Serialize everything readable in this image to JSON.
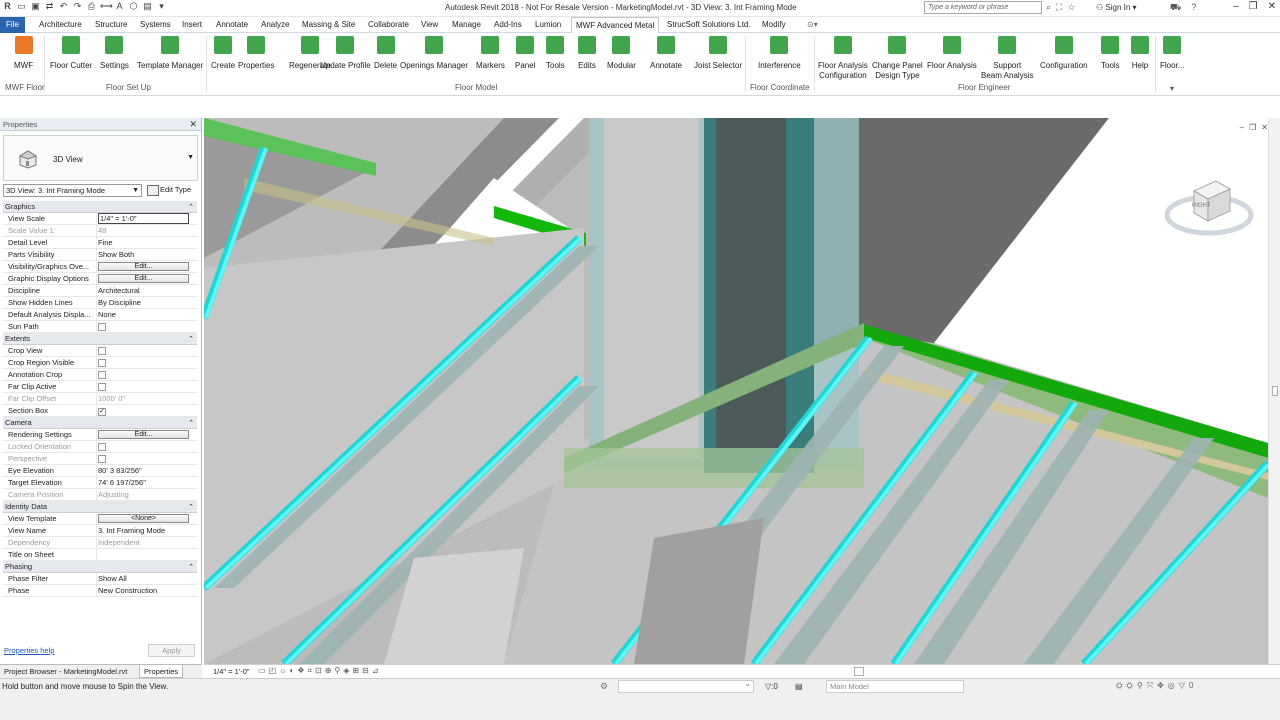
{
  "titlebar": {
    "title": "Autodesk Revit 2018 -  Not For Resale Version -     MarketingModel.rvt - 3D View: 3. Int Framing Mode",
    "search_placeholder": "Type a keyword or phrase",
    "sign_in": "Sign In"
  },
  "menu_tabs": [
    {
      "label": "File"
    },
    {
      "label": "Architecture"
    },
    {
      "label": "Structure"
    },
    {
      "label": "Systems"
    },
    {
      "label": "Insert"
    },
    {
      "label": "Annotate"
    },
    {
      "label": "Analyze"
    },
    {
      "label": "Massing & Site"
    },
    {
      "label": "Collaborate"
    },
    {
      "label": "View"
    },
    {
      "label": "Manage"
    },
    {
      "label": "Add-Ins"
    },
    {
      "label": "Lumion"
    },
    {
      "label": "MWF Advanced Metal"
    },
    {
      "label": "StrucSoft Solutions Ltd."
    },
    {
      "label": "Modify"
    }
  ],
  "ribbon": {
    "buttons": [
      {
        "label": "MWF",
        "icon": "mwf-logo-icon",
        "color": "#e86a10"
      },
      {
        "label": "Floor Cutter",
        "icon": "floor-cutter-icon",
        "color": "#2e9b3a"
      },
      {
        "label": "Settings",
        "icon": "settings-icon",
        "color": "#2e9b3a"
      },
      {
        "label": "Template Manager",
        "icon": "template-manager-icon",
        "color": "#2e9b3a"
      },
      {
        "label": "Create",
        "icon": "create-icon",
        "color": "#2e9b3a"
      },
      {
        "label": "Properties",
        "icon": "properties-icon",
        "color": "#2e9b3a"
      },
      {
        "label": "Regenerate",
        "icon": "regenerate-icon",
        "color": "#2e9b3a"
      },
      {
        "label": "Update Profile",
        "icon": "update-profile-icon",
        "color": "#2e9b3a"
      },
      {
        "label": "Delete",
        "icon": "delete-icon",
        "color": "#2e9b3a"
      },
      {
        "label": "Openings Manager",
        "icon": "openings-manager-icon",
        "color": "#2e9b3a"
      },
      {
        "label": "Markers",
        "icon": "markers-icon",
        "color": "#2e9b3a"
      },
      {
        "label": "Panel",
        "icon": "panel-icon",
        "color": "#2e9b3a"
      },
      {
        "label": "Tools",
        "icon": "tools-icon",
        "color": "#2e9b3a"
      },
      {
        "label": "Edits",
        "icon": "edits-icon",
        "color": "#2e9b3a"
      },
      {
        "label": "Modular",
        "icon": "modular-icon",
        "color": "#2e9b3a"
      },
      {
        "label": "Annotate",
        "icon": "annotate-icon",
        "color": "#2e9b3a"
      },
      {
        "label": "Joist Selector",
        "icon": "joist-selector-icon",
        "color": "#2e9b3a"
      },
      {
        "label": "Interference",
        "icon": "interference-icon",
        "color": "#2e9b3a"
      },
      {
        "label": "Floor Analysis\nConfiguration",
        "icon": "floor-analysis-configuration-icon",
        "color": "#2e9b3a"
      },
      {
        "label": "Change Panel\nDesign Type",
        "icon": "change-panel-design-type-icon",
        "color": "#2e9b3a"
      },
      {
        "label": "Floor Analysis",
        "icon": "floor-analysis-icon",
        "color": "#2e9b3a"
      },
      {
        "label": "Support\nBeam Analysis",
        "icon": "support-beam-analysis-icon",
        "color": "#2e9b3a"
      },
      {
        "label": "Configuration",
        "icon": "configuration-icon",
        "color": "#2e9b3a"
      },
      {
        "label": "Tools",
        "icon": "tools-icon",
        "color": "#2e9b3a"
      },
      {
        "label": "Help",
        "icon": "help-icon",
        "color": "#2e9b3a"
      },
      {
        "label": "Floor...",
        "icon": "floor-panel-icon",
        "color": "#2e9b3a"
      }
    ],
    "panels": [
      {
        "label": "MWF Floor"
      },
      {
        "label": "Floor Set Up"
      },
      {
        "label": "Floor Model"
      },
      {
        "label": "Floor Coordinate"
      },
      {
        "label": "Floor Engineer"
      }
    ]
  },
  "properties": {
    "header": "Properties",
    "type_name": "3D View",
    "instance": "3D View: 3. Int Framing Mode",
    "edit_type": "Edit Type",
    "sections": [
      {
        "name": "Graphics",
        "rows": [
          {
            "k": "View Scale",
            "v": "1/4\" = 1'-0\"",
            "kind": "input"
          },
          {
            "k": "Scale Value    1:",
            "v": "48",
            "kind": "text",
            "disabled": true
          },
          {
            "k": "Detail Level",
            "v": "Fine",
            "kind": "text"
          },
          {
            "k": "Parts Visibility",
            "v": "Show Both",
            "kind": "text"
          },
          {
            "k": "Visibility/Graphics Ove...",
            "v": "Edit...",
            "kind": "button"
          },
          {
            "k": "Graphic Display Options",
            "v": "Edit...",
            "kind": "button"
          },
          {
            "k": "Discipline",
            "v": "Architectural",
            "kind": "text"
          },
          {
            "k": "Show Hidden Lines",
            "v": "By Discipline",
            "kind": "text"
          },
          {
            "k": "Default Analysis Displa...",
            "v": "None",
            "kind": "text"
          },
          {
            "k": "Sun Path",
            "v": "",
            "kind": "check"
          }
        ]
      },
      {
        "name": "Extents",
        "rows": [
          {
            "k": "Crop View",
            "v": "",
            "kind": "check"
          },
          {
            "k": "Crop Region Visible",
            "v": "",
            "kind": "check"
          },
          {
            "k": "Annotation Crop",
            "v": "",
            "kind": "check"
          },
          {
            "k": "Far Clip Active",
            "v": "",
            "kind": "check"
          },
          {
            "k": "Far Clip Offset",
            "v": "1000'  0\"",
            "kind": "text",
            "disabled": true
          },
          {
            "k": "Section Box",
            "v": "✓",
            "kind": "check"
          }
        ]
      },
      {
        "name": "Camera",
        "rows": [
          {
            "k": "Rendering Settings",
            "v": "Edit...",
            "kind": "button"
          },
          {
            "k": "Locked Orientation",
            "v": "",
            "kind": "check",
            "disabled": true
          },
          {
            "k": "Perspective",
            "v": "",
            "kind": "check",
            "disabled": true
          },
          {
            "k": "Eye Elevation",
            "v": "80'  3 83/256\"",
            "kind": "text"
          },
          {
            "k": "Target Elevation",
            "v": "74'  6 197/256\"",
            "kind": "text"
          },
          {
            "k": "Camera Position",
            "v": "Adjusting",
            "kind": "text",
            "disabled": true
          }
        ]
      },
      {
        "name": "Identity Data",
        "rows": [
          {
            "k": "View Template",
            "v": "<None>",
            "kind": "button"
          },
          {
            "k": "View Name",
            "v": "3. Int Framing Mode",
            "kind": "text"
          },
          {
            "k": "Dependency",
            "v": "Independent",
            "kind": "text",
            "disabled": true
          },
          {
            "k": "Title on Sheet",
            "v": "",
            "kind": "text"
          }
        ]
      },
      {
        "name": "Phasing",
        "rows": [
          {
            "k": "Phase Filter",
            "v": "Show All",
            "kind": "text"
          },
          {
            "k": "Phase",
            "v": "New Construction",
            "kind": "text"
          }
        ]
      }
    ],
    "help_link": "Properties help",
    "apply": "Apply"
  },
  "palette_tabs": [
    "Project Browser - MarketingModel.rvt",
    "Properties"
  ],
  "view_bar": {
    "scale": "1/4\" = 1'-0\""
  },
  "viewcube": {
    "face": "RIGHT"
  },
  "status": {
    "message": "Hold button and move mouse to Spin the View.",
    "selection_count": ":0",
    "model": "Main Model",
    "filter_count": "0"
  },
  "colors": {
    "accent": "#2b63ad",
    "green_edge": "#15b20b",
    "cyan_joist": "#5ef4f4",
    "concrete": "#bdbdbd"
  }
}
